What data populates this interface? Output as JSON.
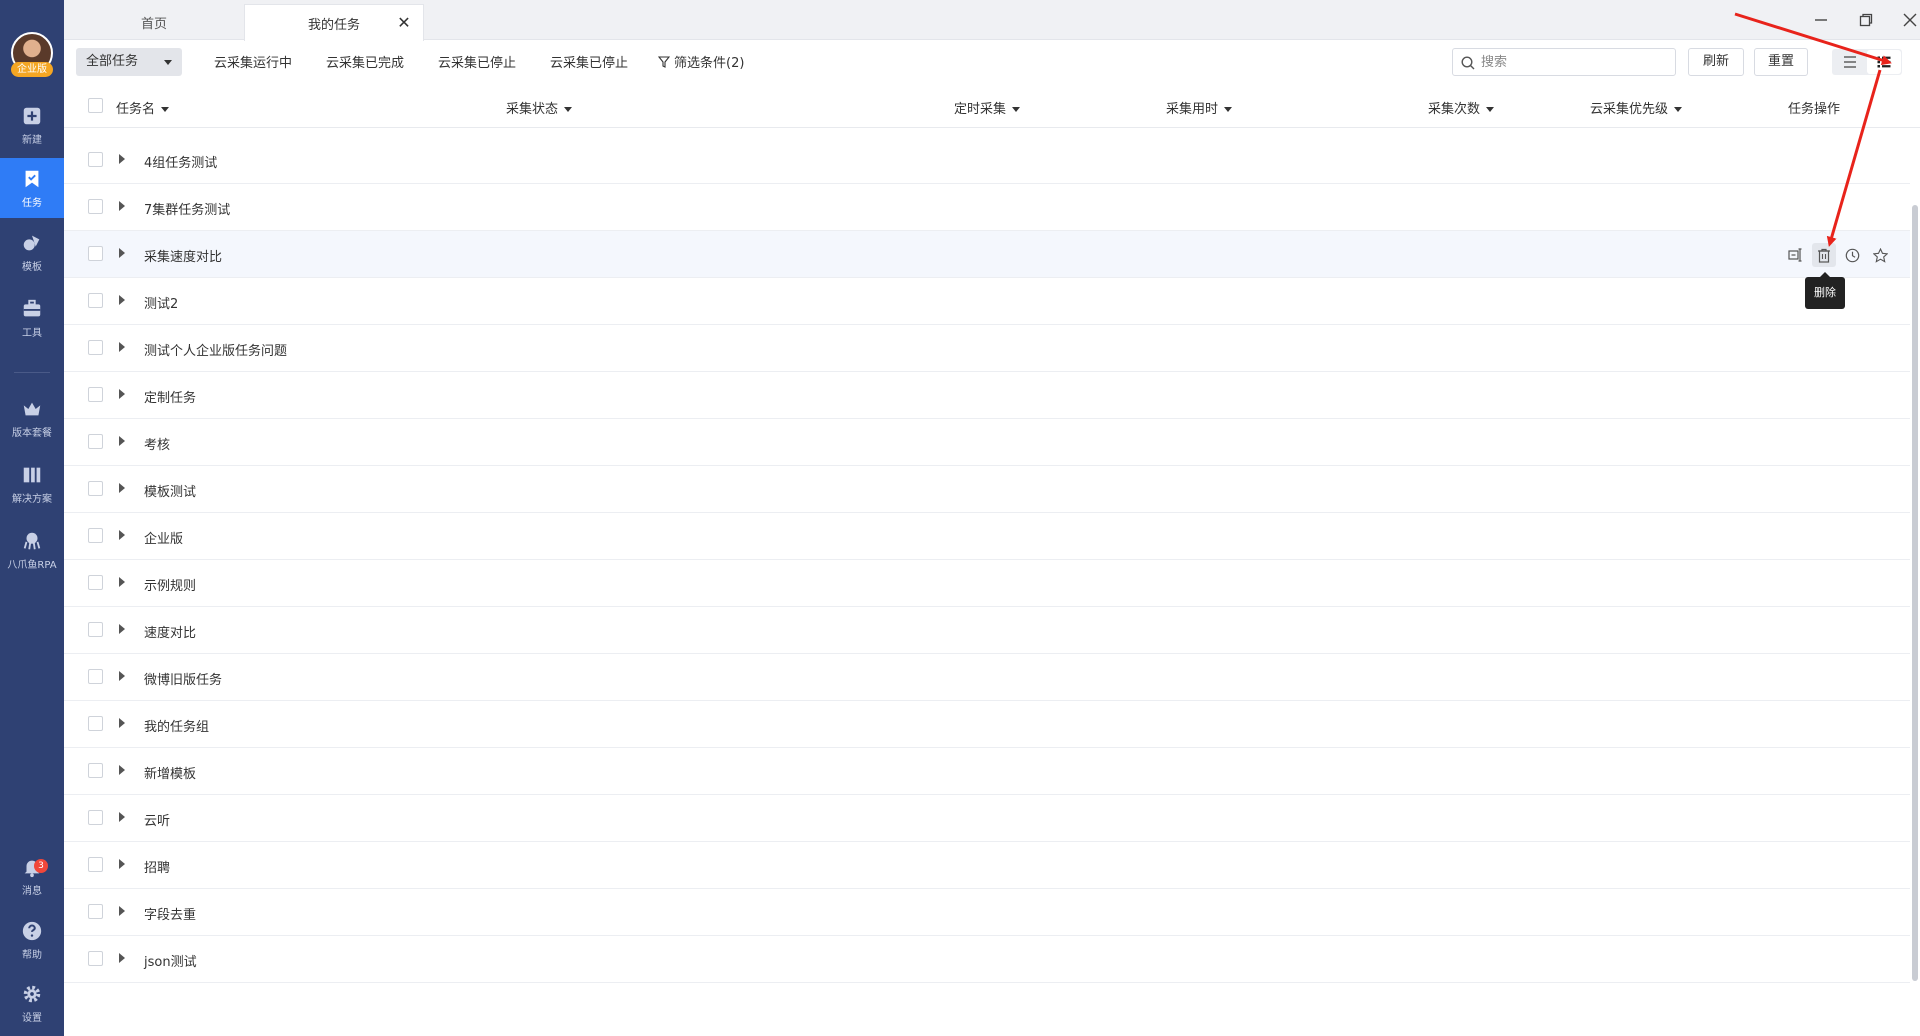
{
  "sidebar": {
    "avatar_badge": "企业版",
    "items": [
      {
        "label": "新建",
        "icon": "plus-square-icon"
      },
      {
        "label": "任务",
        "icon": "bookmark-icon",
        "active": true
      },
      {
        "label": "模板",
        "icon": "template-icon"
      },
      {
        "label": "工具",
        "icon": "toolbox-icon"
      },
      {
        "label": "版本套餐",
        "icon": "crown-icon"
      },
      {
        "label": "解决方案",
        "icon": "solution-icon"
      },
      {
        "label": "八爪鱼RPA",
        "icon": "octopus-icon"
      },
      {
        "label": "消息",
        "icon": "bell-icon",
        "badge": "3"
      },
      {
        "label": "帮助",
        "icon": "help-icon"
      },
      {
        "label": "设置",
        "icon": "gear-icon"
      }
    ]
  },
  "tabs": [
    {
      "label": "首页"
    },
    {
      "label": "我的任务",
      "active": true
    }
  ],
  "toolbar": {
    "filter_select": "全部任务",
    "links": [
      "云采集运行中",
      "云采集已完成",
      "云采集已停止",
      "云采集已停止"
    ],
    "filter_conditions": "筛选条件(2)",
    "search_placeholder": "搜索",
    "refresh": "刷新",
    "reset": "重置"
  },
  "columns": {
    "name": "任务名",
    "status": "采集状态",
    "schedule": "定时采集",
    "duration": "采集用时",
    "count": "采集次数",
    "priority": "云采集优先级",
    "ops": "任务操作"
  },
  "rows": [
    "4组任务测试",
    "7集群任务测试",
    "采集速度对比",
    "测试2",
    "测试个人企业版任务问题",
    "定制任务",
    "考核",
    "模板测试",
    "企业版",
    "示例规则",
    "速度对比",
    "微博旧版任务",
    "我的任务组",
    "新增模板",
    "云听",
    "招聘",
    "字段去重",
    "json测试"
  ],
  "tooltip": "删除",
  "colors": {
    "sidebar": "#2f4173",
    "accent": "#2f7cf6",
    "annotation_arrow": "#e8231b"
  }
}
